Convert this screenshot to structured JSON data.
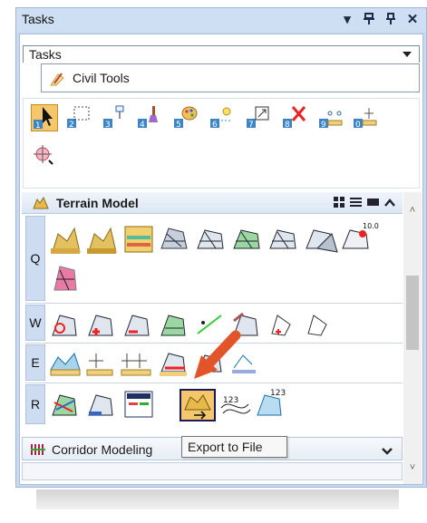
{
  "window": {
    "title": "Tasks"
  },
  "title_buttons": [
    "chevron-down-icon",
    "pin-icon",
    "pin-icon",
    "close-icon"
  ],
  "tasks_dropdown": {
    "value": "Tasks"
  },
  "civil_tab": {
    "label": "Civil Tools"
  },
  "main_tools": {
    "row1": [
      {
        "key": "1",
        "icon": "select-arrow-icon",
        "selected": true
      },
      {
        "key": "2",
        "icon": "select-box-icon"
      },
      {
        "key": "3",
        "icon": "move-icon"
      },
      {
        "key": "4",
        "icon": "brush-icon"
      },
      {
        "key": "5",
        "icon": "palette-icon"
      },
      {
        "key": "6",
        "icon": "light-icon"
      },
      {
        "key": "7",
        "icon": "scale-icon"
      },
      {
        "key": "8",
        "icon": "delete-x-icon"
      },
      {
        "key": "9",
        "icon": "measure-icon"
      },
      {
        "key": "0",
        "icon": "ruler-icon"
      }
    ],
    "row2": [
      {
        "icon": "target-icon"
      }
    ]
  },
  "terrain_model": {
    "label": "Terrain Model",
    "rows": [
      {
        "key": "Q",
        "icons": 9,
        "extra": 1
      },
      {
        "key": "W",
        "icons": 9
      },
      {
        "key": "E",
        "icons": 6
      },
      {
        "key": "R",
        "icons": 6
      }
    ]
  },
  "corridor_modeling": {
    "label": "Corridor Modeling"
  },
  "tooltip": {
    "text": "Export to File"
  },
  "colors": {
    "accent": "#cfdff3",
    "highlight": "#f5c76a",
    "arrow": "#e2542a"
  }
}
